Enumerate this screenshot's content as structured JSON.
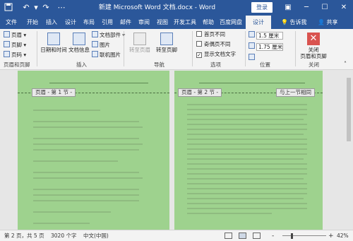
{
  "title_bar": {
    "title": "新建 Microsoft Word 文档.docx - Word",
    "login": "登录",
    "icons": [
      "save-icon",
      "undo-icon",
      "redo-icon",
      "customize-icon"
    ]
  },
  "tabs": {
    "items": [
      "文件",
      "开始",
      "插入",
      "设计",
      "布局",
      "引用",
      "邮件",
      "审阅",
      "视图",
      "开发工具",
      "帮助",
      "百度网盘",
      "设计"
    ],
    "tell_me": "告诉我",
    "share": "共享"
  },
  "ribbon": {
    "header_footer": {
      "header": "页眉",
      "footer": "页脚",
      "page_number": "页码",
      "label": "页眉和页脚"
    },
    "insert": {
      "date_time": "日期和时间",
      "doc_info": "文档信息",
      "doc_parts": "文档部件",
      "picture": "图片",
      "online_picture": "联机图片",
      "label": "插入"
    },
    "navigation": {
      "goto_header": "转至页眉",
      "goto_footer": "转至页脚",
      "label": "导航"
    },
    "options": {
      "diff_first": "首页不同",
      "diff_odd_even": "奇偶页不同",
      "show_doc_text": "显示文档文字",
      "show_doc_text_checked": true,
      "label": "选项"
    },
    "position": {
      "header_top": "1.5 厘米",
      "footer_bottom": "1.75 厘米",
      "label": "位置"
    },
    "close": {
      "button": "关闭\n页眉和页脚",
      "button_line1": "关闭",
      "button_line2": "页眉和页脚",
      "label": "关闭"
    }
  },
  "document": {
    "left_header": "页眉 - 第 1 节 -",
    "right_header": "页眉 - 第 2 节 -",
    "link_to_previous": "与上一节相同",
    "page_color": "#9ed28e"
  },
  "status": {
    "page": "第 2 页，共 5 页",
    "words": "3020 个字",
    "language": "中文(中国)",
    "zoom": "42%",
    "zoom_minus": "-",
    "zoom_plus": "+"
  },
  "colors": {
    "accent": "#2b579a",
    "ribbon": "#f3f3f3"
  }
}
